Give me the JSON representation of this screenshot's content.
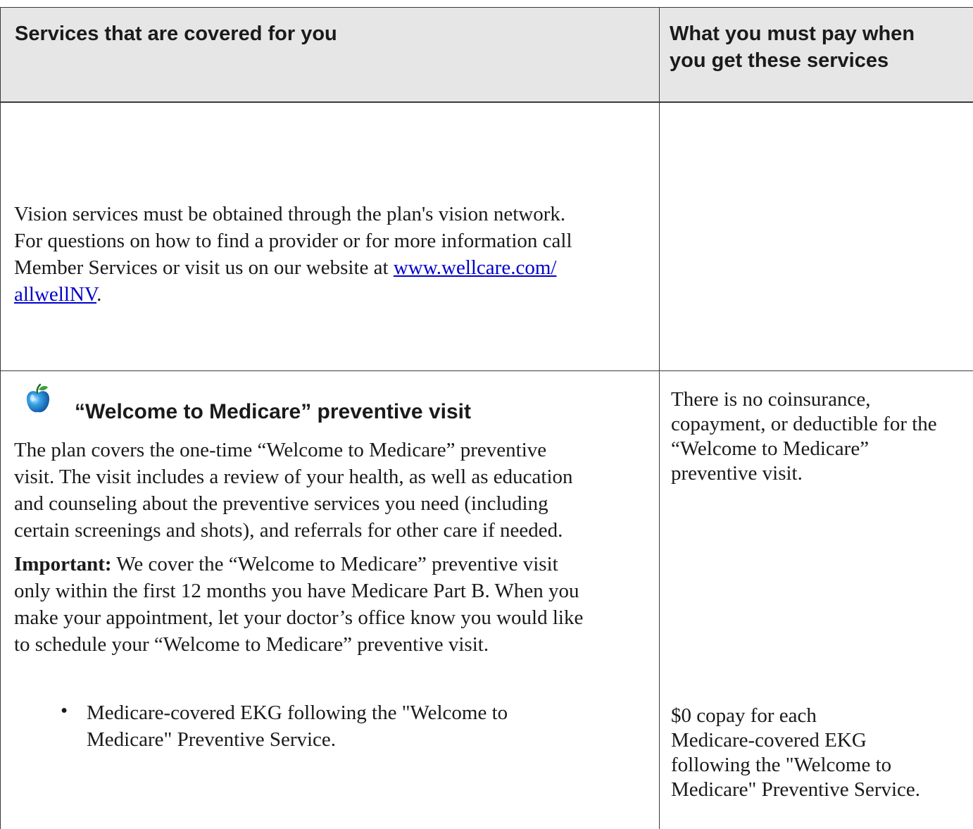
{
  "header": {
    "col1": "Services that are covered for you",
    "col2_line1": "What you must pay when",
    "col2_line2": "you get these services"
  },
  "vision": {
    "line1": "Vision services must be obtained through the plan's vision network.",
    "line2": "For questions on how to find a provider or for more information call",
    "line3_prefix": "Member Services or visit us on our website at ",
    "link_part1": "www.wellcare.com/",
    "link_part2": "allwellNV",
    "line4_suffix": "."
  },
  "welcome": {
    "icon": "apple-icon",
    "title": "“Welcome to Medicare” preventive visit",
    "desc_lines": [
      "The plan covers the one-time “Welcome to Medicare” preventive",
      "visit. The visit includes a review of your health, as well as education",
      "and counseling about the preventive services you need (including",
      "certain screenings and shots), and referrals for other care if needed."
    ],
    "important_label": "Important:",
    "important_lines": [
      " We cover the “Welcome to Medicare” preventive visit",
      "only within the first 12 months you have Medicare Part B. When you",
      "make your appointment, let your doctor’s office know you would like",
      "to schedule your “Welcome to Medicare” preventive visit."
    ],
    "cost_lines": [
      "There is no coinsurance,",
      "copayment, or deductible for the",
      "“Welcome to Medicare”",
      "preventive visit."
    ]
  },
  "ekg": {
    "bullet": "•",
    "lines": [
      "Medicare-covered EKG following the \"Welcome to",
      "Medicare\" Preventive Service."
    ],
    "cost_lines": [
      "$0 copay for each",
      "Medicare-covered EKG",
      "following the \"Welcome to",
      "Medicare\" Preventive Service."
    ]
  }
}
